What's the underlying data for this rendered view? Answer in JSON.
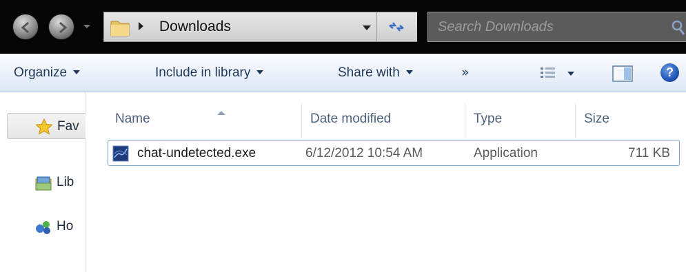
{
  "window": {
    "breadcrumb": "Downloads",
    "search_placeholder": "Search Downloads"
  },
  "toolbar": {
    "organize": "Organize",
    "include_in_library": "Include in library",
    "share_with": "Share with",
    "more": "»"
  },
  "nav_pane": {
    "favorites": "Fav",
    "libraries": "Lib",
    "homegroup": "Ho"
  },
  "columns": {
    "name": "Name",
    "date_modified": "Date modified",
    "type": "Type",
    "size": "Size"
  },
  "files": [
    {
      "name": "chat-undetected.exe",
      "date_modified": "6/12/2012 10:54 AM",
      "type": "Application",
      "size": "711 KB",
      "icon": "application-exe-icon"
    }
  ],
  "icons": {
    "back": "back-arrow-icon",
    "forward": "forward-arrow-icon",
    "folder": "folder-icon",
    "refresh": "refresh-icon",
    "search": "search-icon",
    "views": "views-icon",
    "preview_pane": "preview-pane-icon",
    "help": "help-icon",
    "favorites": "star-icon",
    "libraries": "library-icon",
    "homegroup": "homegroup-icon"
  }
}
